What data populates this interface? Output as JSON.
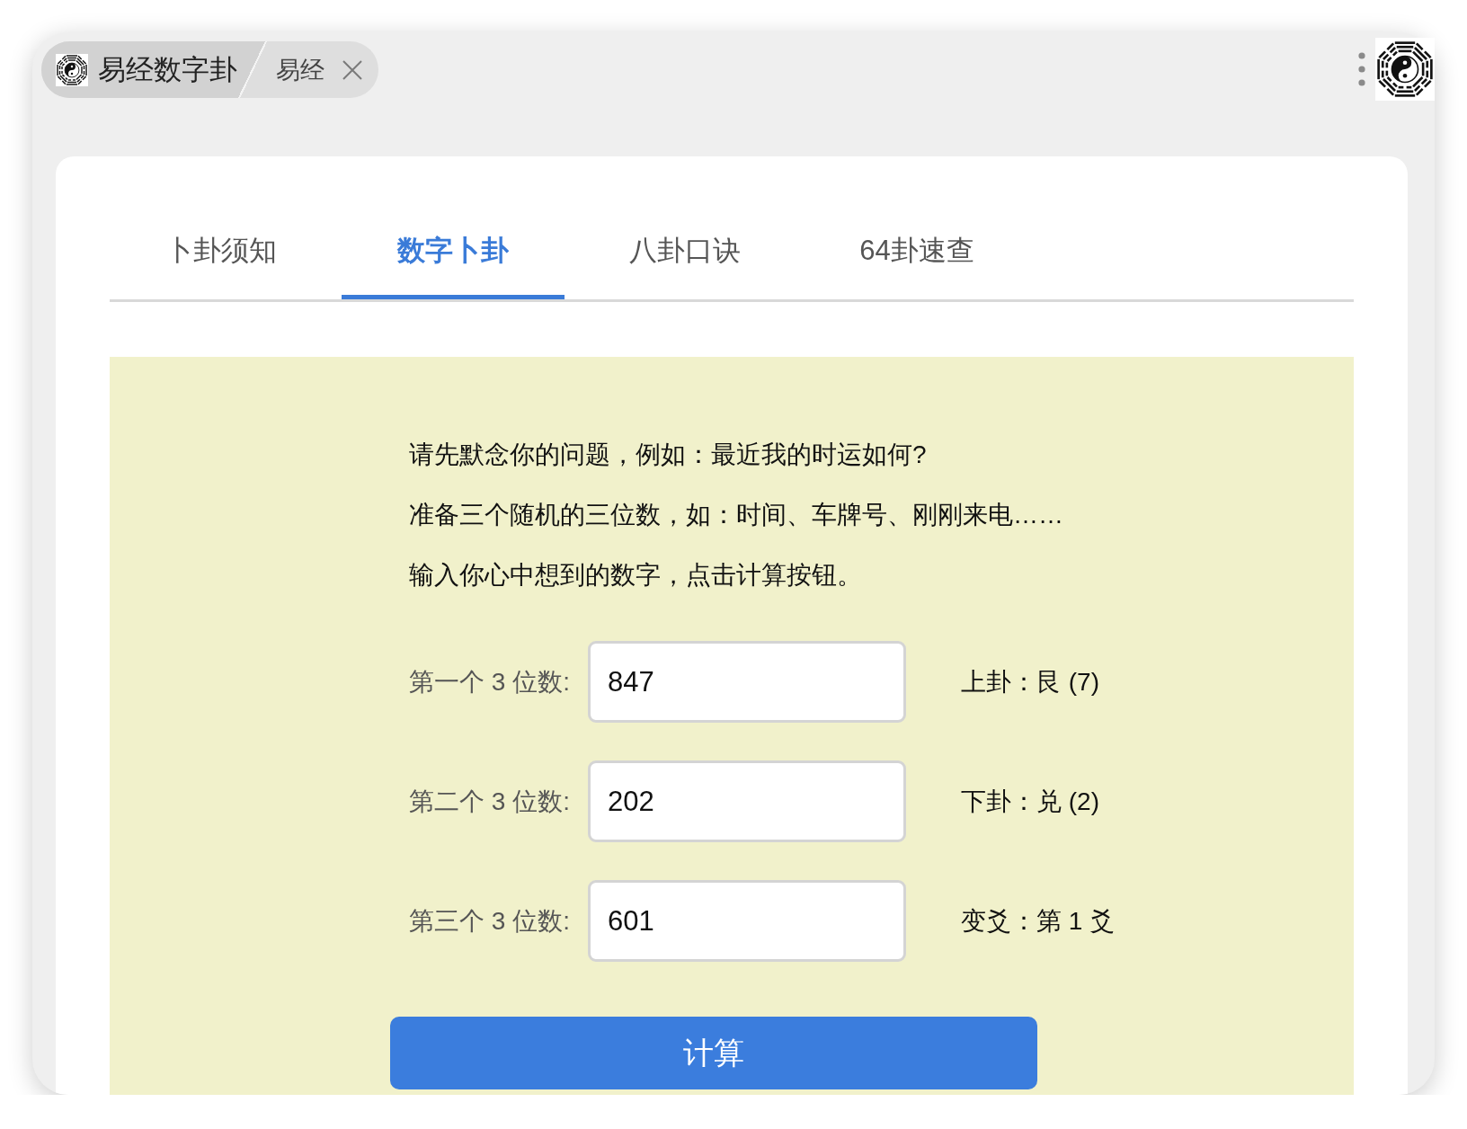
{
  "browser_tabs": [
    {
      "kind": "app",
      "label": "易经数字卦",
      "selected": true
    },
    {
      "kind": "page",
      "label": "易经",
      "selected": false
    }
  ],
  "tabs": [
    {
      "label": "卜卦须知",
      "selected": false
    },
    {
      "label": "数字卜卦",
      "selected": true
    },
    {
      "label": "八卦口诀",
      "selected": false
    },
    {
      "label": "64卦速查",
      "selected": false
    }
  ],
  "instructions": [
    "请先默念你的问题，例如：最近我的时运如何?",
    "准备三个随机的三位数，如：时间、车牌号、刚刚来电……",
    "输入你心中想到的数字，点击计算按钮。"
  ],
  "inputs": [
    {
      "label": "第一个 3 位数:",
      "value": "847",
      "result": "上卦：艮 (7)"
    },
    {
      "label": "第二个 3 位数:",
      "value": "202",
      "result": "下卦：兑 (2)"
    },
    {
      "label": "第三个 3 位数:",
      "value": "601",
      "result": "变爻：第 1 爻"
    }
  ],
  "button": {
    "label": "计算"
  }
}
